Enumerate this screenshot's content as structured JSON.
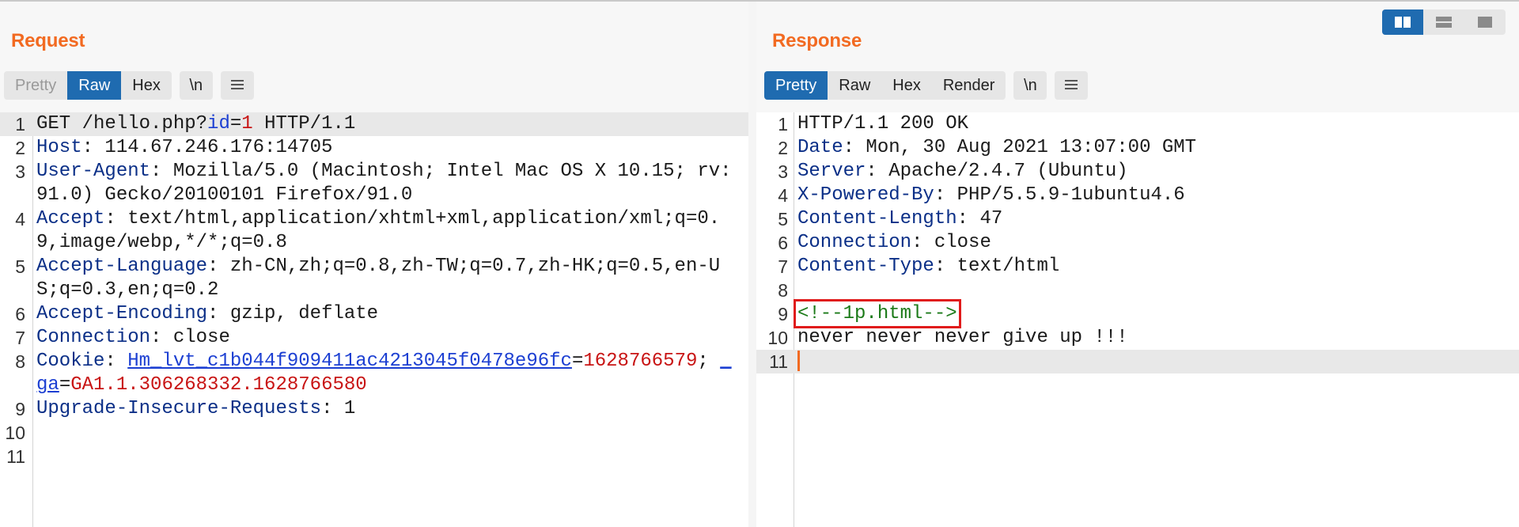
{
  "request": {
    "title": "Request",
    "tabs": [
      {
        "label": "Pretty",
        "state": "disabled"
      },
      {
        "label": "Raw",
        "state": "active"
      },
      {
        "label": "Hex",
        "state": "normal"
      }
    ],
    "newline_label": "\\n",
    "lines": [
      {
        "n": "1",
        "segs": [
          [
            "p",
            "GET /hello.php?"
          ],
          [
            "b",
            "id"
          ],
          [
            "p",
            "="
          ],
          [
            "r",
            "1"
          ],
          [
            "p",
            " HTTP/1.1"
          ]
        ],
        "highlight": true
      },
      {
        "n": "2",
        "segs": [
          [
            "k",
            "Host"
          ],
          [
            "p",
            ": 114.67.246.176:14705"
          ]
        ]
      },
      {
        "n": "3",
        "segs": [
          [
            "k",
            "User-Agent"
          ],
          [
            "p",
            ": Mozilla/5.0 (Macintosh; Intel Mac OS X 10.15; rv:91.0) Gecko/20100101 Firefox/91.0"
          ]
        ]
      },
      {
        "n": "4",
        "segs": [
          [
            "k",
            "Accept"
          ],
          [
            "p",
            ": text/html,application/xhtml+xml,application/xml;q=0.9,image/webp,*/*;q=0.8"
          ]
        ]
      },
      {
        "n": "5",
        "segs": [
          [
            "k",
            "Accept-Language"
          ],
          [
            "p",
            ": zh-CN,zh;q=0.8,zh-TW;q=0.7,zh-HK;q=0.5,en-US;q=0.3,en;q=0.2"
          ]
        ]
      },
      {
        "n": "6",
        "segs": [
          [
            "k",
            "Accept-Encoding"
          ],
          [
            "p",
            ": gzip, deflate"
          ]
        ]
      },
      {
        "n": "7",
        "segs": [
          [
            "k",
            "Connection"
          ],
          [
            "p",
            ": close"
          ]
        ]
      },
      {
        "n": "8",
        "segs": [
          [
            "k",
            "Cookie"
          ],
          [
            "p",
            ": "
          ],
          [
            "u",
            "Hm_lvt_c1b044f909411ac4213045f0478e96fc"
          ],
          [
            "p",
            "="
          ],
          [
            "r",
            "1628766579"
          ],
          [
            "p",
            "; "
          ],
          [
            "u",
            "_ga"
          ],
          [
            "p",
            "="
          ],
          [
            "r",
            "GA1.1.306268332.1628766580"
          ]
        ]
      },
      {
        "n": "9",
        "segs": [
          [
            "k",
            "Upgrade-Insecure-Requests"
          ],
          [
            "p",
            ": 1"
          ]
        ]
      },
      {
        "n": "10",
        "segs": []
      },
      {
        "n": "11",
        "segs": []
      }
    ]
  },
  "response": {
    "title": "Response",
    "tabs": [
      {
        "label": "Pretty",
        "state": "active"
      },
      {
        "label": "Raw",
        "state": "normal"
      },
      {
        "label": "Hex",
        "state": "normal"
      },
      {
        "label": "Render",
        "state": "normal"
      }
    ],
    "newline_label": "\\n",
    "lines": [
      {
        "n": "1",
        "segs": [
          [
            "p",
            "HTTP/1.1 200 OK"
          ]
        ]
      },
      {
        "n": "2",
        "segs": [
          [
            "k",
            "Date"
          ],
          [
            "p",
            ": Mon, 30 Aug 2021 13:07:00 GMT"
          ]
        ]
      },
      {
        "n": "3",
        "segs": [
          [
            "k",
            "Server"
          ],
          [
            "p",
            ": Apache/2.4.7 (Ubuntu)"
          ]
        ]
      },
      {
        "n": "4",
        "segs": [
          [
            "k",
            "X-Powered-By"
          ],
          [
            "p",
            ": PHP/5.5.9-1ubuntu4.6"
          ]
        ]
      },
      {
        "n": "5",
        "segs": [
          [
            "k",
            "Content-Length"
          ],
          [
            "p",
            ": 47"
          ]
        ]
      },
      {
        "n": "6",
        "segs": [
          [
            "k",
            "Connection"
          ],
          [
            "p",
            ": close"
          ]
        ]
      },
      {
        "n": "7",
        "segs": [
          [
            "k",
            "Content-Type"
          ],
          [
            "p",
            ": text/html"
          ]
        ]
      },
      {
        "n": "8",
        "segs": []
      },
      {
        "n": "9",
        "segs": [
          [
            "g",
            "<!--1p.html-->"
          ]
        ],
        "boxed": true
      },
      {
        "n": "10",
        "segs": [
          [
            "p",
            "never never never give up !!!"
          ]
        ]
      },
      {
        "n": "11",
        "segs": [],
        "highlight": true,
        "caret": true
      }
    ]
  },
  "layout_switch": {
    "options": [
      "side-by-side-icon",
      "stacked-icon",
      "single-pane-icon"
    ],
    "active": "side-by-side-icon"
  },
  "colors": {
    "title": "#f26a21",
    "active_tab": "#1f6bb0",
    "header_name": "#0b2f87",
    "param_name": "#1c3fd2",
    "param_value": "#c81414",
    "comment": "#1b7a18",
    "highlight_box": "#e01b1b"
  }
}
